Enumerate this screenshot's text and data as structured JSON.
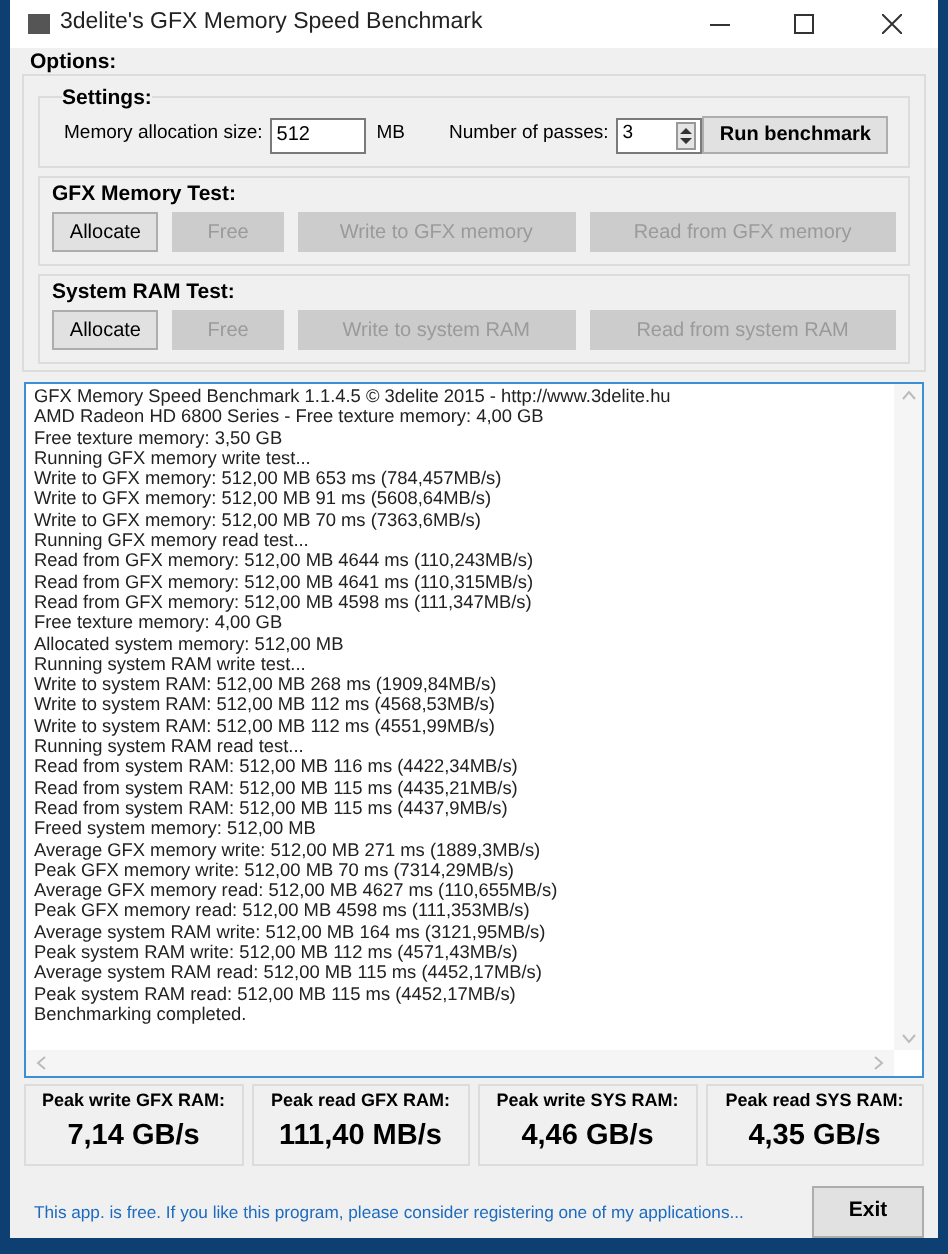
{
  "window": {
    "title": "3delite's GFX Memory Speed Benchmark"
  },
  "options": {
    "label": "Options:"
  },
  "settings": {
    "label": "Settings:",
    "memory_label": "Memory allocation size:",
    "memory_value": "512",
    "memory_unit": "MB",
    "passes_label": "Number of passes:",
    "passes_value": "3",
    "run_button": "Run benchmark"
  },
  "gfx_test": {
    "label": "GFX Memory Test:",
    "buttons": [
      {
        "label": "Allocate",
        "disabled": false
      },
      {
        "label": "Free",
        "disabled": true
      },
      {
        "label": "Write to GFX memory",
        "disabled": true
      },
      {
        "label": "Read from GFX memory",
        "disabled": true
      }
    ]
  },
  "ram_test": {
    "label": "System RAM Test:",
    "buttons": [
      {
        "label": "Allocate",
        "disabled": false
      },
      {
        "label": "Free",
        "disabled": true
      },
      {
        "label": "Write to system RAM",
        "disabled": true
      },
      {
        "label": "Read from system RAM",
        "disabled": true
      }
    ]
  },
  "log": {
    "lines": [
      "GFX Memory Speed Benchmark 1.1.4.5 © 3delite 2015 - http://www.3delite.hu",
      "AMD Radeon HD 6800 Series - Free texture memory: 4,00 GB",
      "Free texture memory: 3,50 GB",
      "Running GFX memory write test...",
      "Write to GFX memory: 512,00 MB 653 ms (784,457MB/s)",
      "Write to GFX memory: 512,00 MB 91 ms (5608,64MB/s)",
      "Write to GFX memory: 512,00 MB 70 ms (7363,6MB/s)",
      "Running GFX memory read test...",
      "Read from GFX memory: 512,00 MB 4644 ms (110,243MB/s)",
      "Read from GFX memory: 512,00 MB 4641 ms (110,315MB/s)",
      "Read from GFX memory: 512,00 MB 4598 ms (111,347MB/s)",
      "Free texture memory: 4,00 GB",
      "Allocated system memory: 512,00 MB",
      "Running system RAM write test...",
      "Write to system RAM: 512,00 MB 268 ms (1909,84MB/s)",
      "Write to system RAM: 512,00 MB 112 ms (4568,53MB/s)",
      "Write to system RAM: 512,00 MB 112 ms (4551,99MB/s)",
      "Running system RAM read test...",
      "Read from system RAM: 512,00 MB 116 ms (4422,34MB/s)",
      "Read from system RAM: 512,00 MB 115 ms (4435,21MB/s)",
      "Read from system RAM: 512,00 MB 115 ms (4437,9MB/s)",
      "Freed system memory: 512,00 MB",
      "Average GFX memory write: 512,00 MB 271 ms (1889,3MB/s)",
      "Peak GFX memory write: 512,00 MB 70 ms (7314,29MB/s)",
      "Average GFX memory read: 512,00 MB 4627 ms (110,655MB/s)",
      "Peak GFX memory read: 512,00 MB 4598 ms (111,353MB/s)",
      "Average system RAM write: 512,00 MB 164 ms (3121,95MB/s)",
      "Peak system RAM write: 512,00 MB 112 ms (4571,43MB/s)",
      "Average system RAM read: 512,00 MB 115 ms (4452,17MB/s)",
      "Peak system RAM read: 512,00 MB 115 ms (4452,17MB/s)",
      "Benchmarking completed."
    ]
  },
  "results": [
    {
      "label": "Peak write GFX RAM:",
      "value": "7,14 GB/s"
    },
    {
      "label": "Peak read GFX RAM:",
      "value": "111,40 MB/s"
    },
    {
      "label": "Peak write SYS RAM:",
      "value": "4,46 GB/s"
    },
    {
      "label": "Peak read SYS RAM:",
      "value": "4,35 GB/s"
    }
  ],
  "footer": {
    "note": "This app. is free. If you like this program, please consider registering one of my applications...",
    "exit_button": "Exit"
  }
}
